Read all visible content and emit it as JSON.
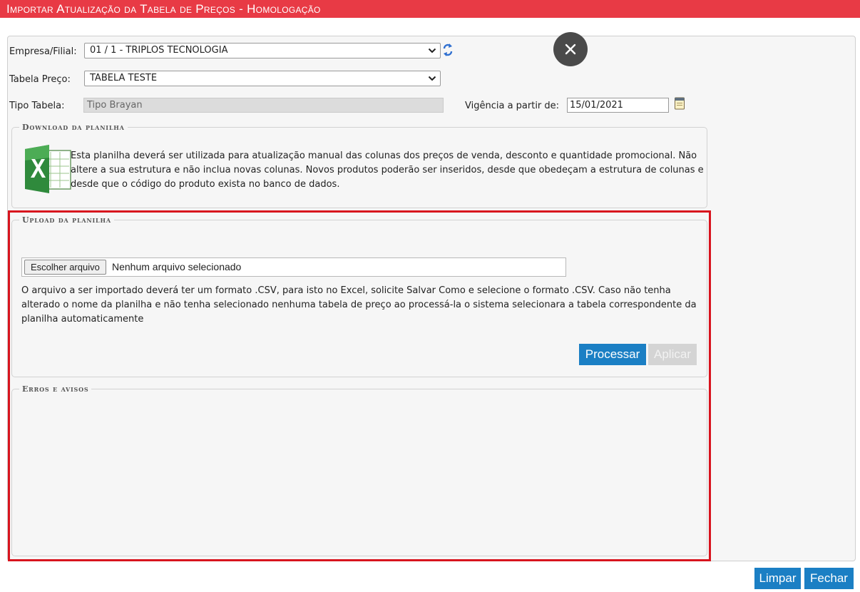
{
  "window": {
    "title": "Importar Atualização da Tabela de Preços  - Homologação"
  },
  "form": {
    "empresa_label": "Empresa/Filial:",
    "empresa_value": "01 / 1 - TRIPLOS TECNOLOGIA",
    "tabela_label": "Tabela Preço:",
    "tabela_value": "TABELA TESTE",
    "tipo_label": "Tipo Tabela:",
    "tipo_value": "Tipo Brayan",
    "vigencia_label": "Vigência a partir de:",
    "vigencia_value": "15/01/2021"
  },
  "download": {
    "legend": "Download da planilha",
    "text": "Esta planilha deverá ser utilizada para atualização manual das colunas dos preços de venda, desconto e quantidade promocional. Não altere a sua estrutura e não inclua novas colunas. Novos produtos poderão ser inseridos, desde que obedeçam a estrutura de colunas e desde que o código do produto exista no banco de dados."
  },
  "upload": {
    "legend": "Upload da planilha",
    "choose_label": "Escolher arquivo",
    "file_status": "Nenhum arquivo selecionado",
    "text": "O arquivo a ser importado deverá ter um formato .CSV, para isto no Excel, solicite Salvar Como e selecione o formato .CSV. Caso não tenha alterado o nome da planilha e não tenha selecionado nenhuma tabela de preço ao processá-la o sistema selecionara a tabela correspondente da planilha automaticamente",
    "process_label": "Processar",
    "apply_label": "Aplicar"
  },
  "errors": {
    "legend": "Erros e avisos"
  },
  "footer": {
    "clear_label": "Limpar",
    "close_label": "Fechar"
  },
  "icons": {
    "refresh": "refresh-icon",
    "calendar": "calendar-icon",
    "excel": "excel-icon",
    "close": "close-icon",
    "chevron": "chevron-down-icon"
  },
  "colors": {
    "title_bar": "#e83a45",
    "primary_button": "#1b7fc4",
    "highlight_outline": "#d8141e",
    "panel": "#f6f6f6"
  }
}
